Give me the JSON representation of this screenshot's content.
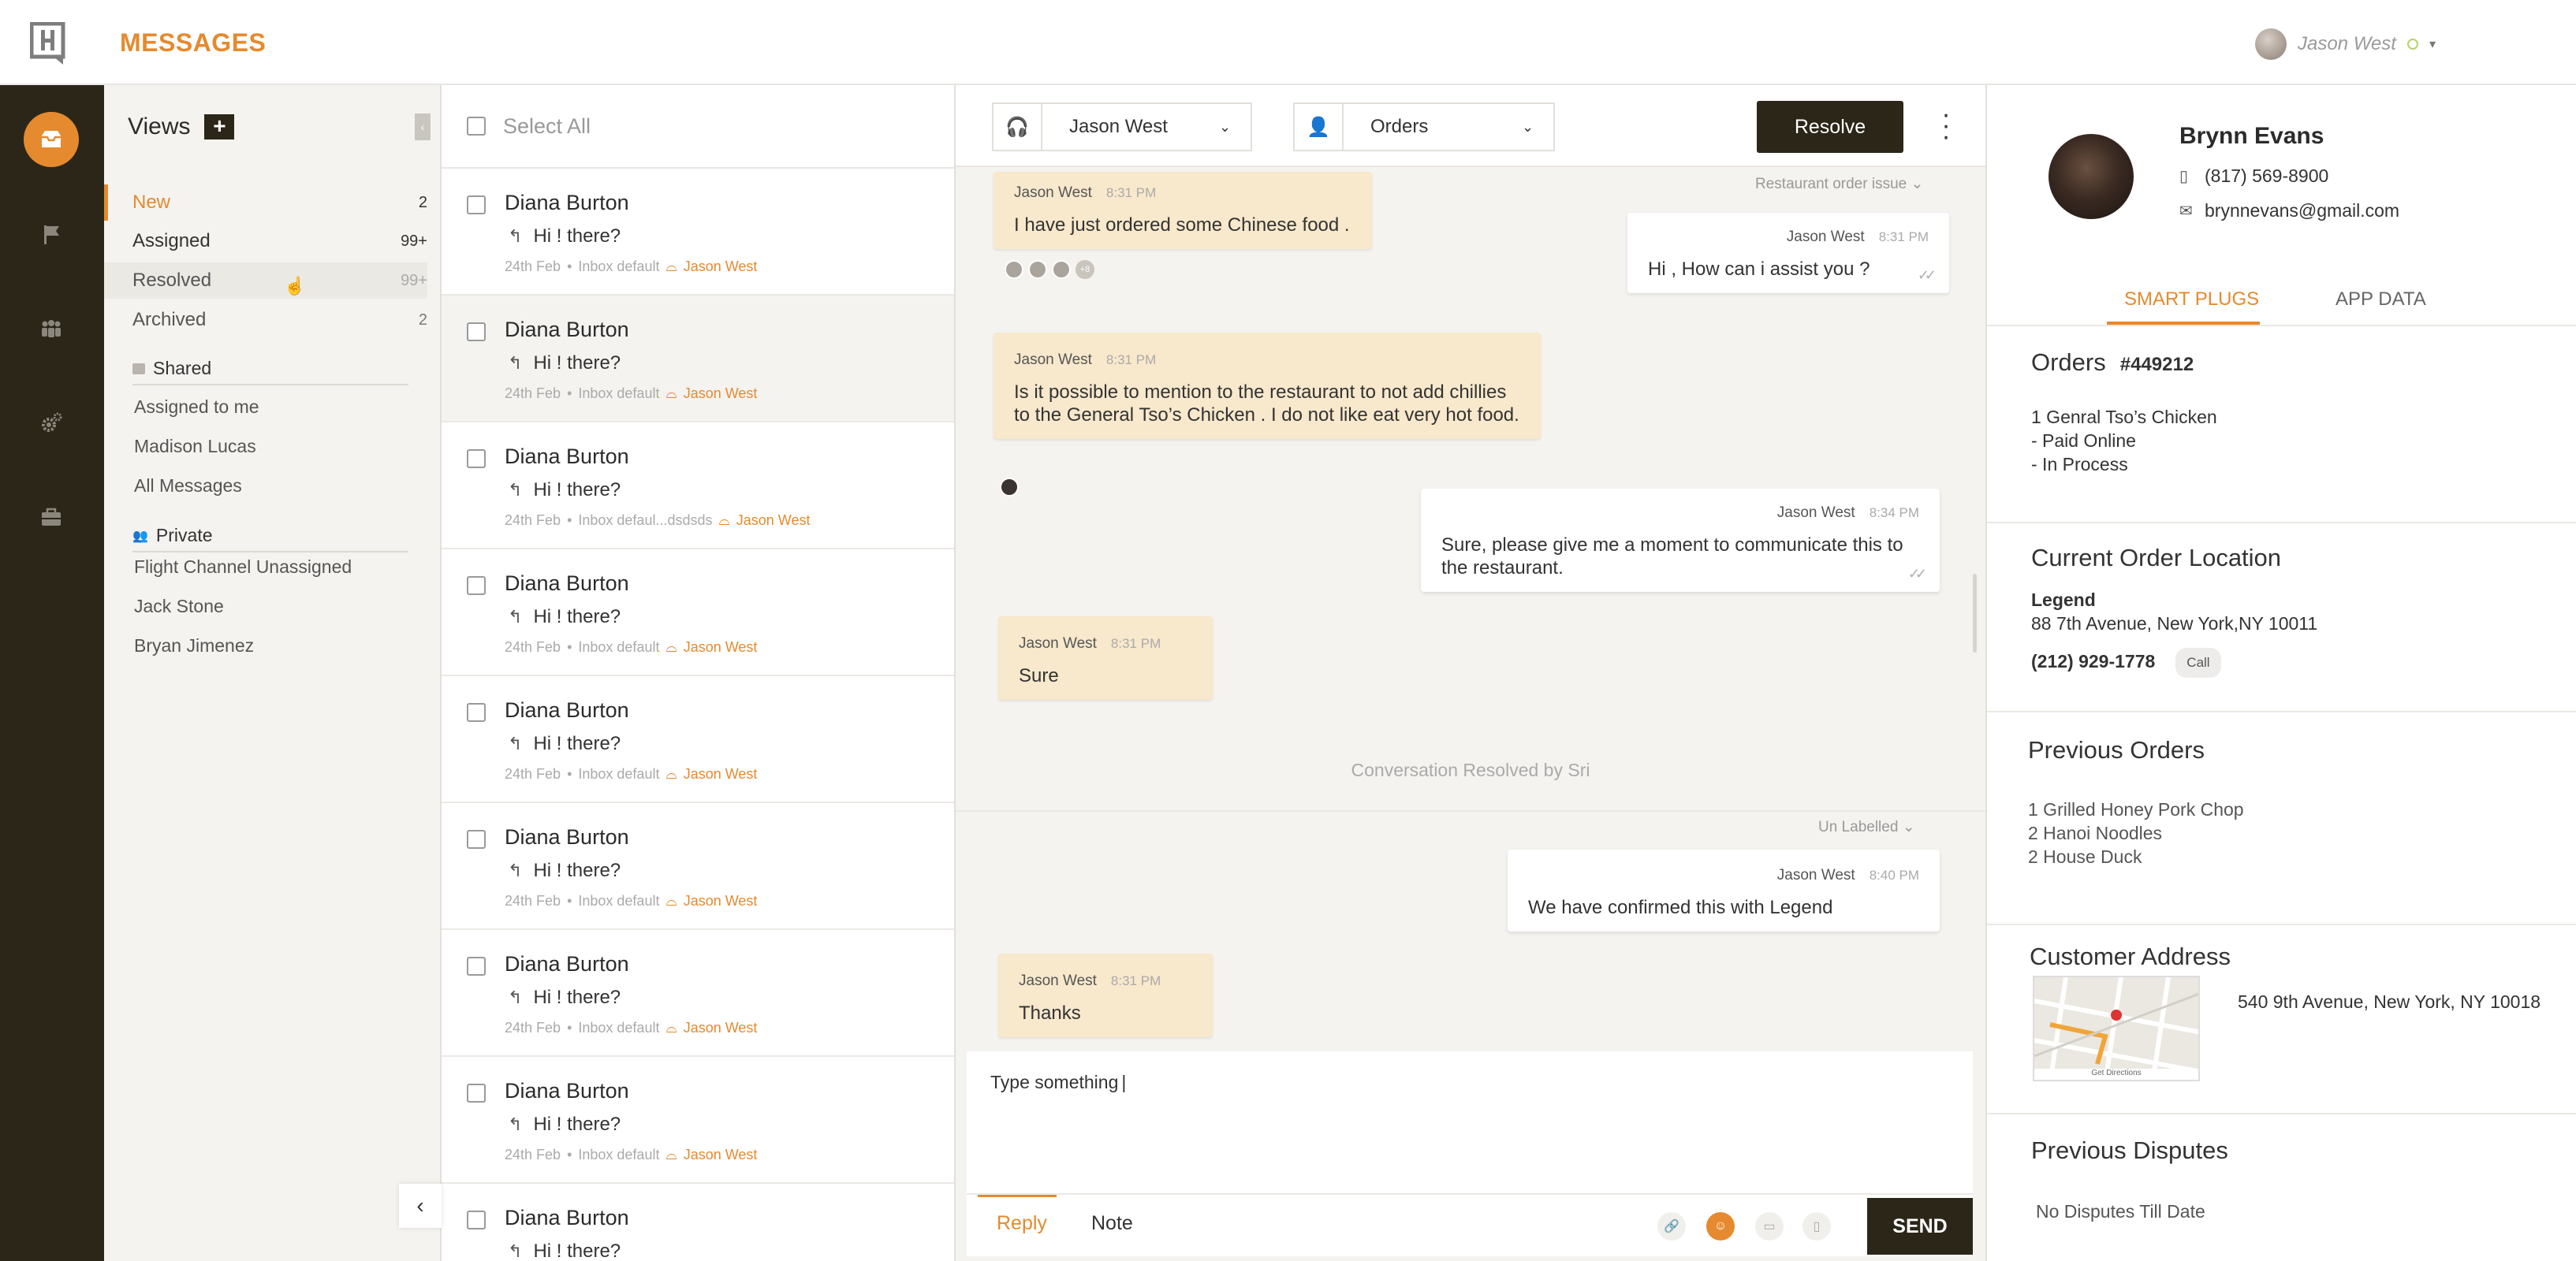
{
  "app": {
    "title": "MESSAGES"
  },
  "user": {
    "name": "Jason West"
  },
  "views": {
    "title": "Views",
    "items": [
      {
        "label": "New",
        "count": "2"
      },
      {
        "label": "Assigned",
        "count": "99+"
      },
      {
        "label": "Resolved",
        "count": "99+"
      },
      {
        "label": "Archived",
        "count": "2"
      }
    ],
    "shared": {
      "title": "Shared",
      "items": [
        "Assigned to me",
        "Madison Lucas",
        "All Messages"
      ]
    },
    "private": {
      "title": "Private",
      "items": [
        "Flight Channel Unassigned",
        "Jack Stone",
        "Bryan Jimenez"
      ]
    }
  },
  "list": {
    "select_all": "Select All",
    "rows": [
      {
        "from": "Diana Burton",
        "preview": "Hi ! there?",
        "date": "24th Feb",
        "inbox": "Inbox default",
        "agent": "Jason West"
      },
      {
        "from": "Diana Burton",
        "preview": "Hi ! there?",
        "date": "24th Feb",
        "inbox": "Inbox default",
        "agent": "Jason West"
      },
      {
        "from": "Diana Burton",
        "preview": "Hi ! there?",
        "date": "24th Feb",
        "inbox": "Inbox defaul...dsdsds",
        "agent": "Jason West"
      },
      {
        "from": "Diana Burton",
        "preview": "Hi ! there?",
        "date": "24th Feb",
        "inbox": "Inbox default",
        "agent": "Jason West"
      },
      {
        "from": "Diana Burton",
        "preview": "Hi ! there?",
        "date": "24th Feb",
        "inbox": "Inbox default",
        "agent": "Jason West"
      },
      {
        "from": "Diana Burton",
        "preview": "Hi ! there?",
        "date": "24th Feb",
        "inbox": "Inbox default",
        "agent": "Jason West"
      },
      {
        "from": "Diana Burton",
        "preview": "Hi ! there?",
        "date": "24th Feb",
        "inbox": "Inbox default",
        "agent": "Jason West"
      },
      {
        "from": "Diana Burton",
        "preview": "Hi ! there?",
        "date": "24th Feb",
        "inbox": "Inbox default",
        "agent": "Jason West"
      },
      {
        "from": "Diana Burton",
        "preview": "Hi ! there?",
        "date": "",
        "inbox": "",
        "agent": ""
      }
    ]
  },
  "chat": {
    "assignee": "Jason West",
    "team": "Orders",
    "resolve_label": "Resolve",
    "label_1": "Restaurant order issue",
    "label_2": "Un Labelled",
    "avatar_more": "+8",
    "resolved_note": "Conversation Resolved by Sri",
    "messages": [
      {
        "author": "Jason West",
        "time": "8:31 PM",
        "text": "I have just ordered some Chinese food ."
      },
      {
        "author": "Jason West",
        "time": "8:31 PM",
        "text": "Hi , How can i assist you ?"
      },
      {
        "author": "Jason West",
        "time": "8:31 PM",
        "text": "Is it possible to mention to the restaurant to not add chillies to the General Tso’s Chicken  . I do not like eat very hot food."
      },
      {
        "author": "Jason West",
        "time": "8:34 PM",
        "text": "Sure, please give me a moment to communicate this to the restaurant."
      },
      {
        "author": "Jason West",
        "time": "8:31 PM",
        "text": "Sure"
      },
      {
        "author": "Jason West",
        "time": "8:40 PM",
        "text": "We have confirmed this with Legend"
      },
      {
        "author": "Jason West",
        "time": "8:31 PM",
        "text": "Thanks"
      }
    ],
    "composer": {
      "placeholder": "Type something",
      "tab_reply": "Reply",
      "tab_note": "Note",
      "send": "SEND"
    }
  },
  "customer": {
    "name": "Brynn Evans",
    "phone": "(817) 569-8900",
    "email": "brynnevans@gmail.com",
    "tabs": [
      "SMART PLUGS",
      "APP DATA"
    ],
    "orders": {
      "title": "Orders",
      "order_no": "#449212",
      "lines": [
        "1   Genral Tso’s Chicken",
        "-  Paid Online",
        "-  In Process"
      ]
    },
    "location": {
      "title": "Current Order Location",
      "place": "Legend",
      "address": "88 7th Avenue, New York,NY 10011",
      "phone": "(212) 929-1778",
      "call": "Call"
    },
    "previous_orders": {
      "title": "Previous Orders",
      "lines": [
        "1 Grilled Honey Pork Chop",
        "2 Hanoi Noodles",
        "2 House Duck"
      ]
    },
    "address": {
      "title": "Customer Address",
      "text": "540 9th Avenue, New York, NY 10018",
      "map_caption": "Get Directions"
    },
    "disputes": {
      "title": "Previous Disputes",
      "text": "No Disputes Till Date"
    }
  },
  "colors": {
    "accent": "#e58a2e",
    "dark": "#2b2618",
    "bubble_in": "#f8e8cc"
  }
}
